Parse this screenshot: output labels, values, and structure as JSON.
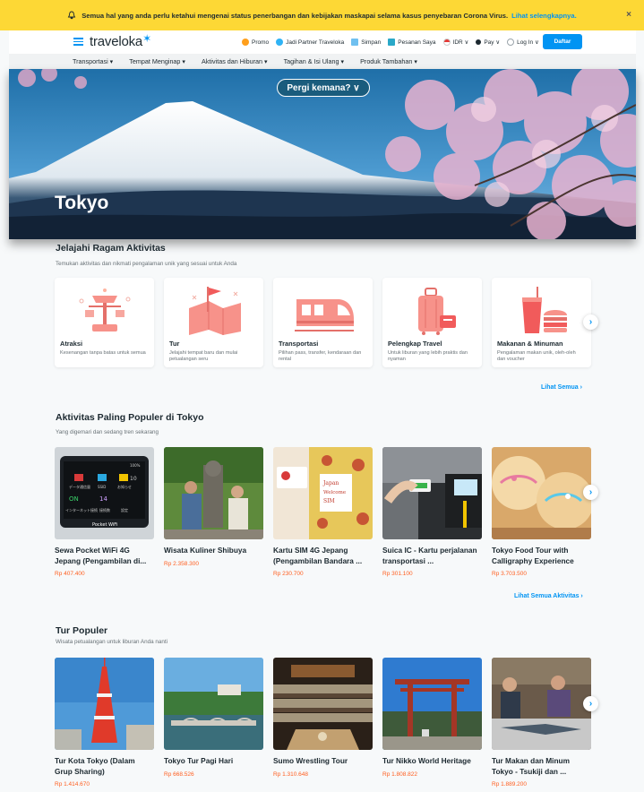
{
  "notice": {
    "text": "Semua hal yang anda perlu ketahui mengenai status penerbangan dan kebijakan maskapai selama kasus penyebaran Corona Virus.",
    "link": "Lihat selengkapnya.",
    "close": "×"
  },
  "header": {
    "logo": "traveloka",
    "nav": [
      "Promo",
      "Jadi Partner Traveloka",
      "Simpan",
      "Pesanan Saya",
      "IDR ∨",
      "Pay ∨",
      "Log In ∨"
    ],
    "register": "Daftar"
  },
  "subnav": [
    "Transportasi ▾",
    "Tempat Menginap ▾",
    "Aktivitas dan Hiburan ▾",
    "Tagihan & Isi Ulang ▾",
    "Produk Tambahan ▾"
  ],
  "hero": {
    "destination_button": "Pergi kemana? ∨",
    "city": "Tokyo"
  },
  "categories_section": {
    "title": "Jelajahi Ragam Aktivitas",
    "subtitle": "Temukan aktivitas dan nikmati pengalaman unik yang sesuai untuk Anda",
    "see_all": "Lihat Semua  ›",
    "items": [
      {
        "title": "Atraksi",
        "desc": "Kesenangan tanpa batas untuk semua",
        "icon": "carousel-icon"
      },
      {
        "title": "Tur",
        "desc": "Jelajahi tempat baru dan mulai petualangan seru",
        "icon": "map-flag-icon"
      },
      {
        "title": "Transportasi",
        "desc": "Pilihan pass, transfer, kendaraan dan rental",
        "icon": "train-icon"
      },
      {
        "title": "Pelengkap Travel",
        "desc": "Untuk liburan yang lebih praktis dan nyaman",
        "icon": "luggage-icon"
      },
      {
        "title": "Makanan & Minuman",
        "desc": "Pengalaman makan unik, oleh-oleh dan voucher",
        "icon": "food-icon"
      }
    ]
  },
  "popular_section": {
    "title": "Aktivitas Paling Populer di Tokyo",
    "subtitle": "Yang digemari dan sedang tren sekarang",
    "see_all": "Lihat Semua Aktivitas  ›",
    "items": [
      {
        "name": "Sewa Pocket WiFi 4G Jepang (Pengambilan di...",
        "price": "Rp 407.400"
      },
      {
        "name": "Wisata Kuliner Shibuya",
        "price": "Rp 2.358.300"
      },
      {
        "name": "Kartu SIM 4G Jepang (Pengambilan Bandara ...",
        "price": "Rp 230.700"
      },
      {
        "name": "Suica IC - Kartu perjalanan transportasi ...",
        "price": "Rp 301.100"
      },
      {
        "name": "Tokyo Food Tour with Calligraphy Experience",
        "price": "Rp 3.703.500"
      }
    ],
    "wifi_screen": [
      "データ通信量",
      "SSID",
      "お知らせ",
      "ON",
      "14",
      "インターネット接続",
      "接続数",
      "設定",
      "Pocket WiFi",
      "100%",
      "10"
    ],
    "sim_card": [
      "Japan",
      "Welcome",
      "SIM"
    ]
  },
  "tours_section": {
    "title": "Tur Populer",
    "subtitle": "Wisata petualangan untuk liburan Anda nanti",
    "items": [
      {
        "name": "Tur Kota Tokyo (Dalam Grup Sharing)",
        "price": "Rp 1.414.670"
      },
      {
        "name": "Tokyo Tur Pagi Hari",
        "price": "Rp 668.526"
      },
      {
        "name": "Sumo Wrestling Tour",
        "price": "Rp 1.310.648"
      },
      {
        "name": "Tur Nikko World Heritage",
        "price": "Rp 1.808.822"
      },
      {
        "name": "Tur Makan dan Minum Tokyo - Tsukiji dan ...",
        "price": "Rp 1.889.200"
      }
    ]
  },
  "colors": {
    "brand": "#0194f3",
    "price": "#ff5e1f",
    "notice": "#fdd835"
  }
}
